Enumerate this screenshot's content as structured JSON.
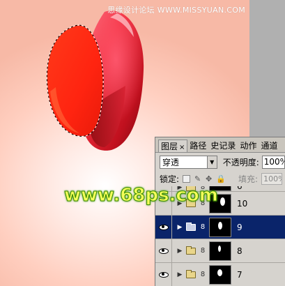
{
  "watermark_top": "思缘设计论坛 WWW.MISSYUAN.COM",
  "watermark_logo": "www.68ps.com",
  "layers_panel": {
    "tabs": [
      {
        "label": "图层",
        "active": true,
        "close": "×"
      },
      {
        "label": "路径"
      },
      {
        "label": "史记录"
      },
      {
        "label": "动作"
      },
      {
        "label": "通道"
      }
    ],
    "blend_mode": "穿透",
    "opacity_label": "不透明度:",
    "opacity_value": "100%",
    "lock_label": "锁定:",
    "fill_label": "填充:",
    "fill_value": "100%",
    "layers": [
      {
        "name": "6",
        "visible": false,
        "selected": false,
        "partial": true
      },
      {
        "name": "10",
        "visible": false,
        "selected": false
      },
      {
        "name": "9",
        "visible": true,
        "selected": true
      },
      {
        "name": "8",
        "visible": true,
        "selected": false
      },
      {
        "name": "7",
        "visible": true,
        "selected": false
      }
    ]
  },
  "colors": {
    "selected_row": "#0a246a",
    "petal_red": "#ff2a12",
    "background_pink": "#ffcfc0"
  }
}
